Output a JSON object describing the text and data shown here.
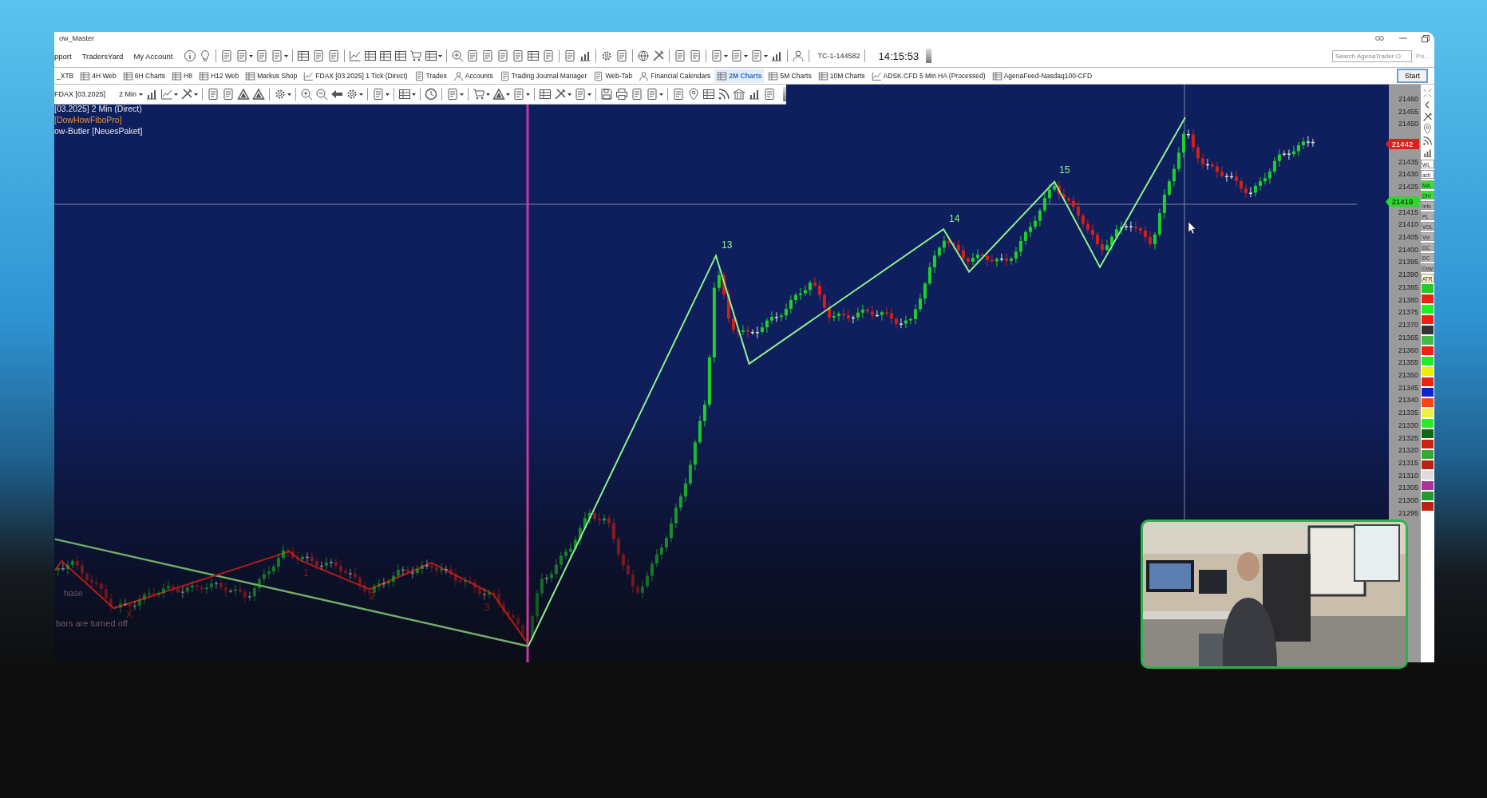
{
  "window": {
    "title": "ow_Master"
  },
  "menu": [
    {
      "label": "pport"
    },
    {
      "label": "TradersYard"
    },
    {
      "label": "My Account"
    }
  ],
  "connection": "TC-1-144582",
  "clock": "14:15:53",
  "search": {
    "placeholder": "Search AgenaTrader O"
  },
  "pane_label": "Poi...",
  "start_button": "Start",
  "tabs": [
    {
      "label": "_XTB",
      "kind": "plain",
      "selected": false
    },
    {
      "label": "4H Web",
      "kind": "table",
      "selected": false
    },
    {
      "label": "6H Charts",
      "kind": "table",
      "selected": false
    },
    {
      "label": "H8",
      "kind": "table",
      "selected": false
    },
    {
      "label": "H12 Web",
      "kind": "table",
      "selected": false
    },
    {
      "label": "Markus Shop",
      "kind": "table",
      "selected": false
    },
    {
      "label": "FDAX [03.2025] 1 Tick (Direct)",
      "kind": "line",
      "selected": false
    },
    {
      "label": "Trades",
      "kind": "other",
      "selected": false
    },
    {
      "label": "Accounts",
      "kind": "person",
      "selected": false
    },
    {
      "label": "Trading Journal Manager",
      "kind": "other",
      "selected": false
    },
    {
      "label": "Web-Tab",
      "kind": "other",
      "selected": false
    },
    {
      "label": "Financial Calendars",
      "kind": "person",
      "selected": false
    },
    {
      "label": "2M Charts",
      "kind": "table",
      "selected": true
    },
    {
      "label": "5M Charts",
      "kind": "table",
      "selected": false
    },
    {
      "label": "10M Charts",
      "kind": "table",
      "selected": false
    },
    {
      "label": "ADSK.CFD 5 Min HA (Processed)",
      "kind": "line",
      "selected": false
    },
    {
      "label": "AgenaFeed-Nasdaq100-CFD",
      "kind": "table",
      "selected": false
    }
  ],
  "chart_toolbar": {
    "instrument": "FDAX [03.2025]",
    "timeframe": "2 Min"
  },
  "chart": {
    "legend": [
      {
        "text": "[03.2025] 2 Min (Direct)",
        "kind": "series"
      },
      {
        "text": "[DowHowFiboPro]",
        "kind": "indicator"
      },
      {
        "text": "ow-Butler [NeuesPaket]",
        "kind": "series"
      }
    ],
    "wave_labels": [
      "13",
      "14",
      "15"
    ],
    "sub_wave_labels": [
      "X",
      "1",
      "2",
      "3"
    ],
    "notes": [
      "hase",
      "bars are turned off"
    ],
    "price_axis": {
      "ticks": [
        "21460",
        "21455",
        "21450",
        "21435",
        "21430",
        "21425",
        "21415",
        "21410",
        "21405",
        "21400",
        "21395",
        "21390",
        "21385",
        "21380",
        "21375",
        "21370",
        "21365",
        "21360",
        "21355",
        "21350",
        "21345",
        "21340",
        "21335",
        "21330",
        "21325",
        "21320",
        "21315",
        "21310",
        "21305",
        "21300",
        "21295"
      ],
      "markers": [
        {
          "text": "21442",
          "kind": "last"
        },
        {
          "text": "21419",
          "kind": "cursor"
        }
      ]
    }
  },
  "side_panel": {
    "labels": [
      {
        "text": "WL",
        "color": "#ffffff"
      },
      {
        "text": "acti",
        "color": "#ffffff"
      },
      {
        "text": "MA",
        "color": "#33e033"
      },
      {
        "text": "DIV",
        "color": "#33e033"
      },
      {
        "text": "Info",
        "color": "#b0b0b0"
      },
      {
        "text": "PL",
        "color": "#b0b0b0"
      },
      {
        "text": "VOL",
        "color": "#b0b0b0"
      },
      {
        "text": "Vol",
        "color": "#b0b0b0"
      },
      {
        "text": "DC",
        "color": "#b0b0b0"
      },
      {
        "text": "DC",
        "color": "#b0b0b0"
      },
      {
        "text": "Dow",
        "color": "#b0b0b0"
      },
      {
        "text": "ATR",
        "color": "#fff8d0"
      }
    ],
    "swatches": [
      {
        "color": "#22cc22"
      },
      {
        "color": "#ee2211"
      },
      {
        "color": "#22ee22"
      },
      {
        "color": "#ee2211"
      },
      {
        "color": "#333333"
      },
      {
        "color": "#44bb44"
      },
      {
        "color": "#ee2211"
      },
      {
        "color": "#22ee22"
      },
      {
        "color": "#eeee00"
      },
      {
        "color": "#ee2211"
      },
      {
        "color": "#1122cc"
      },
      {
        "color": "#ff4411"
      },
      {
        "color": "#eeee44"
      },
      {
        "color": "#22ee22"
      },
      {
        "color": "#116611"
      },
      {
        "color": "#cc2211"
      },
      {
        "color": "#33aa33"
      },
      {
        "color": "#bb2211"
      },
      {
        "color": "#dddddd"
      },
      {
        "color": "#aa3399"
      },
      {
        "color": "#229933"
      },
      {
        "color": "#bb2211"
      }
    ]
  }
}
